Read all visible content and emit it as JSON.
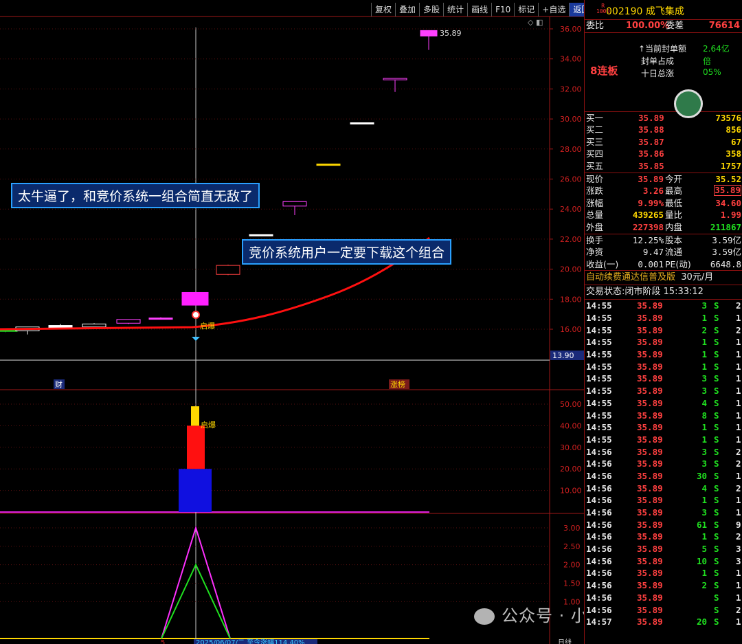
{
  "toolbar": [
    "复权",
    "叠加",
    "多股",
    "统计",
    "画线",
    "F10",
    "标记",
    "+自选",
    "返回"
  ],
  "stock": {
    "market_badge_top": "R",
    "market_badge_bottom": "1000",
    "code_name": "002190 成飞集成"
  },
  "weibi": {
    "label1": "委比",
    "value1": "100.00%",
    "label2": "委差",
    "value2": "76614"
  },
  "seal": {
    "streak": "8连板",
    "line1_label": "↑当前封单额",
    "line1_value": "2.64亿",
    "line2_label": "封单占成",
    "line2_value": "倍",
    "line3_label": "十日总涨",
    "line3_value": "05%"
  },
  "bids": [
    {
      "label": "买一",
      "price": "35.89",
      "vol": "73576"
    },
    {
      "label": "买二",
      "price": "35.88",
      "vol": "856"
    },
    {
      "label": "买三",
      "price": "35.87",
      "vol": "67"
    },
    {
      "label": "买四",
      "price": "35.86",
      "vol": "358"
    },
    {
      "label": "买五",
      "price": "35.85",
      "vol": "1757"
    }
  ],
  "quote": [
    {
      "l1": "现价",
      "v1": "35.89",
      "l2": "今开",
      "v2": "35.52"
    },
    {
      "l1": "涨跌",
      "v1": "3.26",
      "l2": "最高",
      "v2": "35.89"
    },
    {
      "l1": "涨幅",
      "v1": "9.99%",
      "l2": "最低",
      "v2": "34.60"
    },
    {
      "l1": "总量",
      "v1": "439265",
      "l2": "量比",
      "v2": "1.99"
    },
    {
      "l1": "外盘",
      "v1": "227398",
      "l2": "内盘",
      "v2": "211867"
    }
  ],
  "fund": [
    {
      "l1": "换手",
      "v1": "12.25%",
      "l2": "股本",
      "v2": "3.59亿"
    },
    {
      "l1": "净资",
      "v1": "9.47",
      "l2": "流通",
      "v2": "3.59亿"
    },
    {
      "l1": "收益(一)",
      "v1": "0.001",
      "l2": "PE(动)",
      "v2": "6648.8"
    }
  ],
  "ad": {
    "text": "自动续费通达信普及版",
    "price": "30元/月"
  },
  "status": {
    "label": "交易状态:",
    "value": "闭市阶段 15:33:12"
  },
  "trades": [
    {
      "t": "14:55",
      "p": "35.89",
      "v": "3",
      "f": "S",
      "n": "2"
    },
    {
      "t": "14:55",
      "p": "35.89",
      "v": "1",
      "f": "S",
      "n": "1"
    },
    {
      "t": "14:55",
      "p": "35.89",
      "v": "2",
      "f": "S",
      "n": "2"
    },
    {
      "t": "14:55",
      "p": "35.89",
      "v": "1",
      "f": "S",
      "n": "1"
    },
    {
      "t": "14:55",
      "p": "35.89",
      "v": "1",
      "f": "S",
      "n": "1"
    },
    {
      "t": "14:55",
      "p": "35.89",
      "v": "1",
      "f": "S",
      "n": "1"
    },
    {
      "t": "14:55",
      "p": "35.89",
      "v": "3",
      "f": "S",
      "n": "1"
    },
    {
      "t": "14:55",
      "p": "35.89",
      "v": "3",
      "f": "S",
      "n": "1"
    },
    {
      "t": "14:55",
      "p": "35.89",
      "v": "4",
      "f": "S",
      "n": "1"
    },
    {
      "t": "14:55",
      "p": "35.89",
      "v": "8",
      "f": "S",
      "n": "1"
    },
    {
      "t": "14:55",
      "p": "35.89",
      "v": "1",
      "f": "S",
      "n": "1"
    },
    {
      "t": "14:55",
      "p": "35.89",
      "v": "1",
      "f": "S",
      "n": "1"
    },
    {
      "t": "14:56",
      "p": "35.89",
      "v": "3",
      "f": "S",
      "n": "2"
    },
    {
      "t": "14:56",
      "p": "35.89",
      "v": "3",
      "f": "S",
      "n": "2"
    },
    {
      "t": "14:56",
      "p": "35.89",
      "v": "30",
      "f": "S",
      "n": "1"
    },
    {
      "t": "14:56",
      "p": "35.89",
      "v": "4",
      "f": "S",
      "n": "2"
    },
    {
      "t": "14:56",
      "p": "35.89",
      "v": "1",
      "f": "S",
      "n": "1"
    },
    {
      "t": "14:56",
      "p": "35.89",
      "v": "3",
      "f": "S",
      "n": "1"
    },
    {
      "t": "14:56",
      "p": "35.89",
      "v": "61",
      "f": "S",
      "n": "9"
    },
    {
      "t": "14:56",
      "p": "35.89",
      "v": "1",
      "f": "S",
      "n": "2"
    },
    {
      "t": "14:56",
      "p": "35.89",
      "v": "5",
      "f": "S",
      "n": "3"
    },
    {
      "t": "14:56",
      "p": "35.89",
      "v": "10",
      "f": "S",
      "n": "3"
    },
    {
      "t": "14:56",
      "p": "35.89",
      "v": "1",
      "f": "S",
      "n": "1"
    },
    {
      "t": "14:56",
      "p": "35.89",
      "v": "2",
      "f": "S",
      "n": "1"
    },
    {
      "t": "14:56",
      "p": "35.89",
      "v": "",
      "f": "S",
      "n": "1"
    },
    {
      "t": "14:56",
      "p": "35.89",
      "v": "",
      "f": "S",
      "n": "2"
    },
    {
      "t": "14:57",
      "p": "35.89",
      "v": "20",
      "f": "S",
      "n": "1"
    }
  ],
  "chart_data": [
    {
      "type": "candlestick",
      "ylim": [
        14,
        36.4
      ],
      "ticks": [
        "16.00",
        "18.00",
        "20.00",
        "22.00",
        "24.00",
        "26.00",
        "28.00",
        "30.00",
        "32.00",
        "34.00",
        "36.00"
      ],
      "last_price_label": "13.90",
      "max_label": "35.89",
      "candles": [
        {
          "o": 16.0,
          "h": 16.05,
          "l": 15.8,
          "c": 15.85,
          "color": "#20d020",
          "fill": true
        },
        {
          "o": 15.9,
          "h": 16.1,
          "l": 15.65,
          "c": 16.15,
          "color": "#ffffff",
          "fill": false
        },
        {
          "o": 16.1,
          "h": 16.35,
          "l": 16.0,
          "c": 16.25,
          "color": "#ffffff",
          "fill": true
        },
        {
          "o": 16.15,
          "h": 16.4,
          "l": 16.1,
          "c": 16.35,
          "color": "#ffffff",
          "fill": false
        },
        {
          "o": 16.4,
          "h": 16.6,
          "l": 16.35,
          "c": 16.65,
          "color": "#ff40ff",
          "fill": false
        },
        {
          "o": 16.7,
          "h": 16.8,
          "l": 16.65,
          "c": 16.75,
          "color": "#ff40ff",
          "fill": true
        },
        {
          "o": 17.6,
          "h": 18.4,
          "l": 17.6,
          "c": 18.45,
          "color": "#ff20ff",
          "fill": true
        },
        {
          "o": 19.65,
          "h": 20.3,
          "l": 19.6,
          "c": 20.25,
          "color": "#ff4040",
          "fill": false
        },
        {
          "o": 22.3,
          "h": 22.3,
          "l": 22.3,
          "c": 22.25,
          "color": "#ffffff",
          "fill": true
        },
        {
          "o": 24.2,
          "h": 24.45,
          "l": 23.6,
          "c": 24.5,
          "color": "#ff40ff",
          "fill": false
        },
        {
          "o": 27.0,
          "h": 27.0,
          "l": 27.0,
          "c": 26.95,
          "color": "#ffd800",
          "fill": true
        },
        {
          "o": 29.75,
          "h": 29.75,
          "l": 29.75,
          "c": 29.7,
          "color": "#ffffff",
          "fill": true
        },
        {
          "o": 32.7,
          "h": 32.7,
          "l": 31.8,
          "c": 32.65,
          "color": "#ff40ff",
          "fill": false
        },
        {
          "o": 35.52,
          "h": 35.89,
          "l": 34.6,
          "c": 35.89,
          "color": "#ff40ff",
          "fill": true
        }
      ],
      "labels": {
        "bottom_left": "财",
        "bottom_right": "涨榜",
        "burst": "启爆"
      },
      "annotations": [
        "太牛逼了，和竞价系统一组合简直无敌了",
        "竞价系统用户一定要下载这个组合"
      ]
    },
    {
      "type": "bar",
      "ylim": [
        0,
        57
      ],
      "ticks": [
        "10.00",
        "20.00",
        "30.00",
        "40.00",
        "50.00"
      ],
      "bars": [
        {
          "from": 0,
          "to": 20,
          "color": "#1010e0"
        },
        {
          "from": 20,
          "to": 40,
          "color": "#ff1010"
        },
        {
          "from": 40,
          "to": 49,
          "color": "#ffd800"
        }
      ],
      "burst_label": "启爆"
    },
    {
      "type": "line",
      "ylim": [
        0,
        3.2
      ],
      "ticks": [
        "1.00",
        "1.50",
        "2.00",
        "2.50",
        "3.00"
      ],
      "series": [
        {
          "values": [
            0,
            3,
            0
          ],
          "color": "#ff30ff"
        },
        {
          "values": [
            0,
            2,
            0
          ],
          "color": "#20e020"
        }
      ],
      "bottom_text": "2025/06/07/二  至今涨幅114.40%",
      "bottom_left": "5",
      "bottom_right": "日线"
    }
  ],
  "watermark": "公众号 · 小葛同学实盘"
}
